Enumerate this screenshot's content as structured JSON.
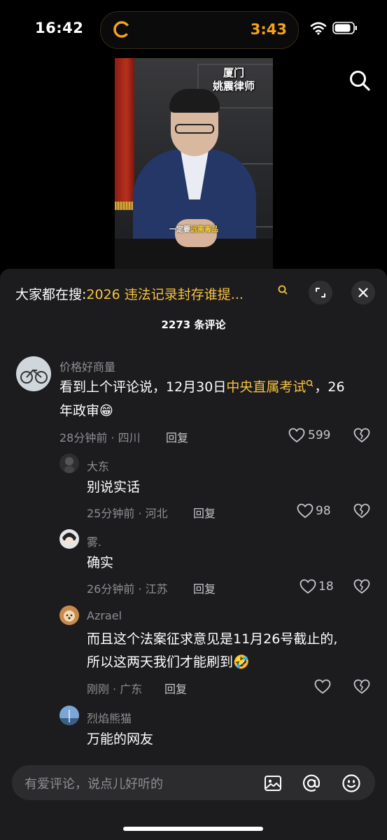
{
  "status_bar": {
    "time": "16:42",
    "timer": "3:43"
  },
  "video": {
    "caption_line1": "厦门",
    "caption_line2": "姚震律师",
    "subtitle_plain": "一定要",
    "subtitle_highlight": "远离毒品"
  },
  "sheet": {
    "trending_prefix": "大家都在搜:",
    "trending_query": "2026 违法记录封存谁提...",
    "comment_count": "2273 条评论"
  },
  "comments": [
    {
      "username": "价格好商量",
      "text_before": "看到上个评论说，12月30日",
      "text_link": "中央直属考试",
      "text_after": "，26",
      "text_line2": "年政审😁",
      "meta": "28分钟前 · 四川",
      "reply_label": "回复",
      "likes": "599"
    },
    {
      "username": "大东",
      "text": "别说实话",
      "meta": "25分钟前 · 河北",
      "reply_label": "回复",
      "likes": "98"
    },
    {
      "username": "雾.",
      "text": "确实",
      "meta": "26分钟前 · 江苏",
      "reply_label": "回复",
      "likes": "18"
    },
    {
      "username": "Azrael",
      "text_line1": "而且这个法案征求意见是11月26号截止的,",
      "text_line2": "所以这两天我们才能刷到🤣",
      "meta": "刚刚 · 广东",
      "reply_label": "回复",
      "likes": ""
    },
    {
      "username": "烈焰熊猫",
      "text": "万能的网友"
    }
  ],
  "input": {
    "placeholder": "有爱评论，说点儿好听的"
  },
  "colors": {
    "accent": "#f6c244",
    "timer": "#f4a21f",
    "sheet_bg": "#1c1c1e"
  }
}
